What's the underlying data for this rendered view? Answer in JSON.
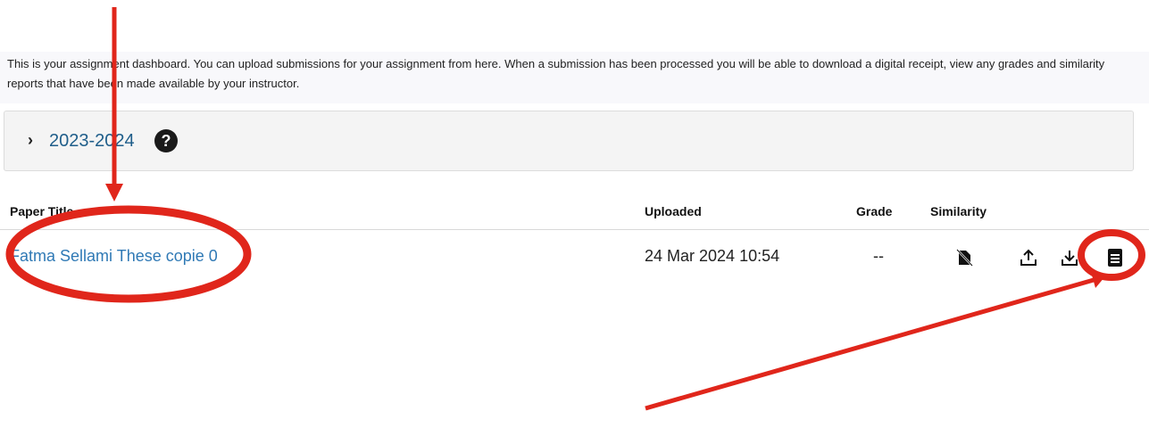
{
  "intro": {
    "text": "This is your assignment dashboard. You can upload submissions for your assignment from here. When a submission has been processed you will be able to download a digital receipt, view any grades and similarity reports that have been made available by your instructor."
  },
  "class_year": {
    "label": "2023-2024",
    "help_symbol": "?"
  },
  "table": {
    "headers": {
      "paper_title": "Paper Title",
      "uploaded": "Uploaded",
      "grade": "Grade",
      "similarity": "Similarity"
    },
    "rows": [
      {
        "title": "Fatma Sellami These copie 0",
        "uploaded": "24 Mar 2024 10:54",
        "grade": "--",
        "similarity_icon": "similarity-unavailable-icon",
        "actions": [
          "upload-icon",
          "download-icon",
          "receipt-icon"
        ]
      }
    ]
  },
  "annotations": {
    "color": "#e0261b"
  },
  "colors": {
    "link": "#2f79b5",
    "year_link": "#1f5e8a"
  }
}
